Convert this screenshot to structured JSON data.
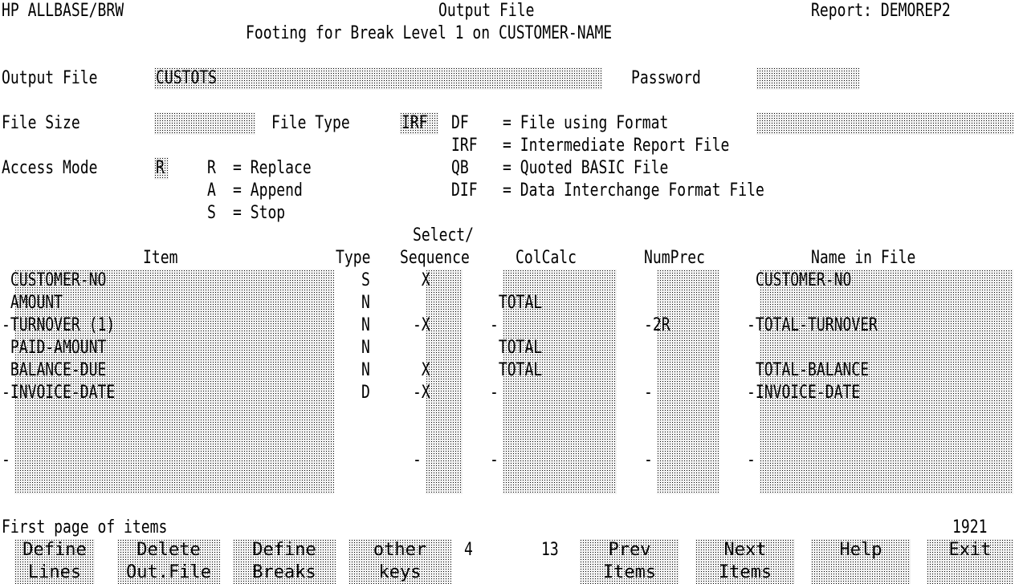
{
  "header": {
    "app": "HP ALLBASE/BRW",
    "screen": "Output File",
    "report": "Report: DEMOREP2",
    "subtitle": "Footing for Break Level 1 on CUSTOMER-NAME"
  },
  "form": {
    "output_file_label": "Output File",
    "output_file_value": "CUSTOTS",
    "password_label": "Password",
    "password_value": "",
    "file_size_label": "File Size",
    "file_size_value": "",
    "file_type_label": "File Type",
    "file_type_value": "IRF",
    "format_value": "",
    "access_mode_label": "Access Mode",
    "access_mode_value": "R"
  },
  "file_types": [
    {
      "code": "DF ",
      "desc": "= File using Format"
    },
    {
      "code": "IRF",
      "desc": "= Intermediate Report File"
    },
    {
      "code": "QB ",
      "desc": "= Quoted BASIC File"
    },
    {
      "code": "DIF",
      "desc": "= Data Interchange Format File"
    }
  ],
  "access_modes": [
    {
      "code": "R",
      "desc": "= Replace"
    },
    {
      "code": "A",
      "desc": "= Append"
    },
    {
      "code": "S",
      "desc": "= Stop"
    }
  ],
  "table": {
    "header_select": "Select/",
    "columns": {
      "item": "Item",
      "type": "Type",
      "sequence": "Sequence",
      "colcalc": "ColCalc",
      "numprec": "NumPrec",
      "name": "Name in File"
    },
    "rows": [
      {
        "item": " CUSTOMER-NO",
        "type": "S",
        "seq": " X",
        "calc": "",
        "prec": "",
        "name": " CUSTOMER-NO"
      },
      {
        "item": " AMOUNT",
        "type": "N",
        "seq": "",
        "calc": " TOTAL",
        "prec": "",
        "name": ""
      },
      {
        "item": "-TURNOVER (1)",
        "type": "N",
        "seq": "-X",
        "calc": "-",
        "prec": "-2R",
        "name": "-TOTAL-TURNOVER"
      },
      {
        "item": " PAID-AMOUNT",
        "type": "N",
        "seq": "",
        "calc": " TOTAL",
        "prec": "",
        "name": ""
      },
      {
        "item": " BALANCE-DUE",
        "type": "N",
        "seq": " X",
        "calc": " TOTAL",
        "prec": "",
        "name": " TOTAL-BALANCE"
      },
      {
        "item": "-INVOICE-DATE",
        "type": "D",
        "seq": "-X",
        "calc": "-",
        "prec": "-",
        "name": "-INVOICE-DATE"
      },
      {
        "item": "",
        "type": "",
        "seq": "",
        "calc": "",
        "prec": "",
        "name": ""
      },
      {
        "item": "",
        "type": "",
        "seq": "",
        "calc": "",
        "prec": "",
        "name": ""
      },
      {
        "item": "-",
        "type": "",
        "seq": "-",
        "calc": "-",
        "prec": "-",
        "name": "-"
      },
      {
        "item": "",
        "type": "",
        "seq": "",
        "calc": "",
        "prec": "",
        "name": ""
      }
    ]
  },
  "status": {
    "message": "First page of items",
    "code": "1921"
  },
  "function_keys": [
    {
      "line1": "Define",
      "line2": "Lines"
    },
    {
      "line1": "Delete",
      "line2": "Out.File"
    },
    {
      "line1": "Define",
      "line2": "Breaks"
    },
    {
      "line1": "other",
      "line2": "keys"
    },
    {
      "line1": "Prev",
      "line2": "Items"
    },
    {
      "line1": "Next",
      "line2": "Items"
    },
    {
      "line1": "Help",
      "line2": ""
    },
    {
      "line1": "Exit",
      "line2": ""
    }
  ],
  "page_indicator": {
    "current": "4",
    "total": "13"
  }
}
